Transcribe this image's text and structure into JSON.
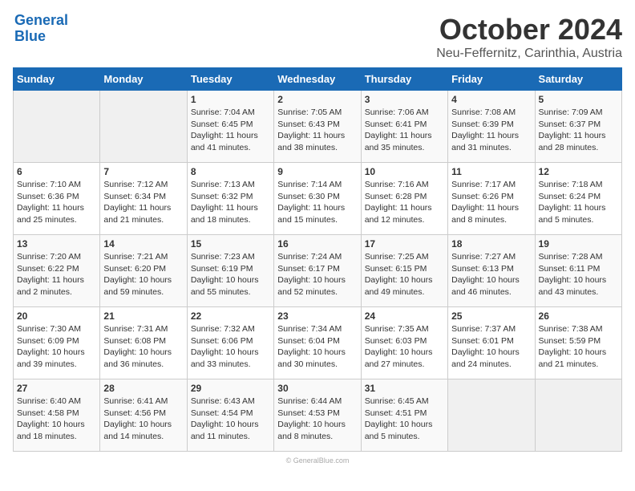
{
  "header": {
    "logo_line1": "General",
    "logo_line2": "Blue",
    "month": "October 2024",
    "location": "Neu-Feffernitz, Carinthia, Austria"
  },
  "weekdays": [
    "Sunday",
    "Monday",
    "Tuesday",
    "Wednesday",
    "Thursday",
    "Friday",
    "Saturday"
  ],
  "weeks": [
    [
      {
        "day": "",
        "info": ""
      },
      {
        "day": "",
        "info": ""
      },
      {
        "day": "1",
        "info": "Sunrise: 7:04 AM\nSunset: 6:45 PM\nDaylight: 11 hours and 41 minutes."
      },
      {
        "day": "2",
        "info": "Sunrise: 7:05 AM\nSunset: 6:43 PM\nDaylight: 11 hours and 38 minutes."
      },
      {
        "day": "3",
        "info": "Sunrise: 7:06 AM\nSunset: 6:41 PM\nDaylight: 11 hours and 35 minutes."
      },
      {
        "day": "4",
        "info": "Sunrise: 7:08 AM\nSunset: 6:39 PM\nDaylight: 11 hours and 31 minutes."
      },
      {
        "day": "5",
        "info": "Sunrise: 7:09 AM\nSunset: 6:37 PM\nDaylight: 11 hours and 28 minutes."
      }
    ],
    [
      {
        "day": "6",
        "info": "Sunrise: 7:10 AM\nSunset: 6:36 PM\nDaylight: 11 hours and 25 minutes."
      },
      {
        "day": "7",
        "info": "Sunrise: 7:12 AM\nSunset: 6:34 PM\nDaylight: 11 hours and 21 minutes."
      },
      {
        "day": "8",
        "info": "Sunrise: 7:13 AM\nSunset: 6:32 PM\nDaylight: 11 hours and 18 minutes."
      },
      {
        "day": "9",
        "info": "Sunrise: 7:14 AM\nSunset: 6:30 PM\nDaylight: 11 hours and 15 minutes."
      },
      {
        "day": "10",
        "info": "Sunrise: 7:16 AM\nSunset: 6:28 PM\nDaylight: 11 hours and 12 minutes."
      },
      {
        "day": "11",
        "info": "Sunrise: 7:17 AM\nSunset: 6:26 PM\nDaylight: 11 hours and 8 minutes."
      },
      {
        "day": "12",
        "info": "Sunrise: 7:18 AM\nSunset: 6:24 PM\nDaylight: 11 hours and 5 minutes."
      }
    ],
    [
      {
        "day": "13",
        "info": "Sunrise: 7:20 AM\nSunset: 6:22 PM\nDaylight: 11 hours and 2 minutes."
      },
      {
        "day": "14",
        "info": "Sunrise: 7:21 AM\nSunset: 6:20 PM\nDaylight: 10 hours and 59 minutes."
      },
      {
        "day": "15",
        "info": "Sunrise: 7:23 AM\nSunset: 6:19 PM\nDaylight: 10 hours and 55 minutes."
      },
      {
        "day": "16",
        "info": "Sunrise: 7:24 AM\nSunset: 6:17 PM\nDaylight: 10 hours and 52 minutes."
      },
      {
        "day": "17",
        "info": "Sunrise: 7:25 AM\nSunset: 6:15 PM\nDaylight: 10 hours and 49 minutes."
      },
      {
        "day": "18",
        "info": "Sunrise: 7:27 AM\nSunset: 6:13 PM\nDaylight: 10 hours and 46 minutes."
      },
      {
        "day": "19",
        "info": "Sunrise: 7:28 AM\nSunset: 6:11 PM\nDaylight: 10 hours and 43 minutes."
      }
    ],
    [
      {
        "day": "20",
        "info": "Sunrise: 7:30 AM\nSunset: 6:09 PM\nDaylight: 10 hours and 39 minutes."
      },
      {
        "day": "21",
        "info": "Sunrise: 7:31 AM\nSunset: 6:08 PM\nDaylight: 10 hours and 36 minutes."
      },
      {
        "day": "22",
        "info": "Sunrise: 7:32 AM\nSunset: 6:06 PM\nDaylight: 10 hours and 33 minutes."
      },
      {
        "day": "23",
        "info": "Sunrise: 7:34 AM\nSunset: 6:04 PM\nDaylight: 10 hours and 30 minutes."
      },
      {
        "day": "24",
        "info": "Sunrise: 7:35 AM\nSunset: 6:03 PM\nDaylight: 10 hours and 27 minutes."
      },
      {
        "day": "25",
        "info": "Sunrise: 7:37 AM\nSunset: 6:01 PM\nDaylight: 10 hours and 24 minutes."
      },
      {
        "day": "26",
        "info": "Sunrise: 7:38 AM\nSunset: 5:59 PM\nDaylight: 10 hours and 21 minutes."
      }
    ],
    [
      {
        "day": "27",
        "info": "Sunrise: 6:40 AM\nSunset: 4:58 PM\nDaylight: 10 hours and 18 minutes."
      },
      {
        "day": "28",
        "info": "Sunrise: 6:41 AM\nSunset: 4:56 PM\nDaylight: 10 hours and 14 minutes."
      },
      {
        "day": "29",
        "info": "Sunrise: 6:43 AM\nSunset: 4:54 PM\nDaylight: 10 hours and 11 minutes."
      },
      {
        "day": "30",
        "info": "Sunrise: 6:44 AM\nSunset: 4:53 PM\nDaylight: 10 hours and 8 minutes."
      },
      {
        "day": "31",
        "info": "Sunrise: 6:45 AM\nSunset: 4:51 PM\nDaylight: 10 hours and 5 minutes."
      },
      {
        "day": "",
        "info": ""
      },
      {
        "day": "",
        "info": ""
      }
    ]
  ]
}
